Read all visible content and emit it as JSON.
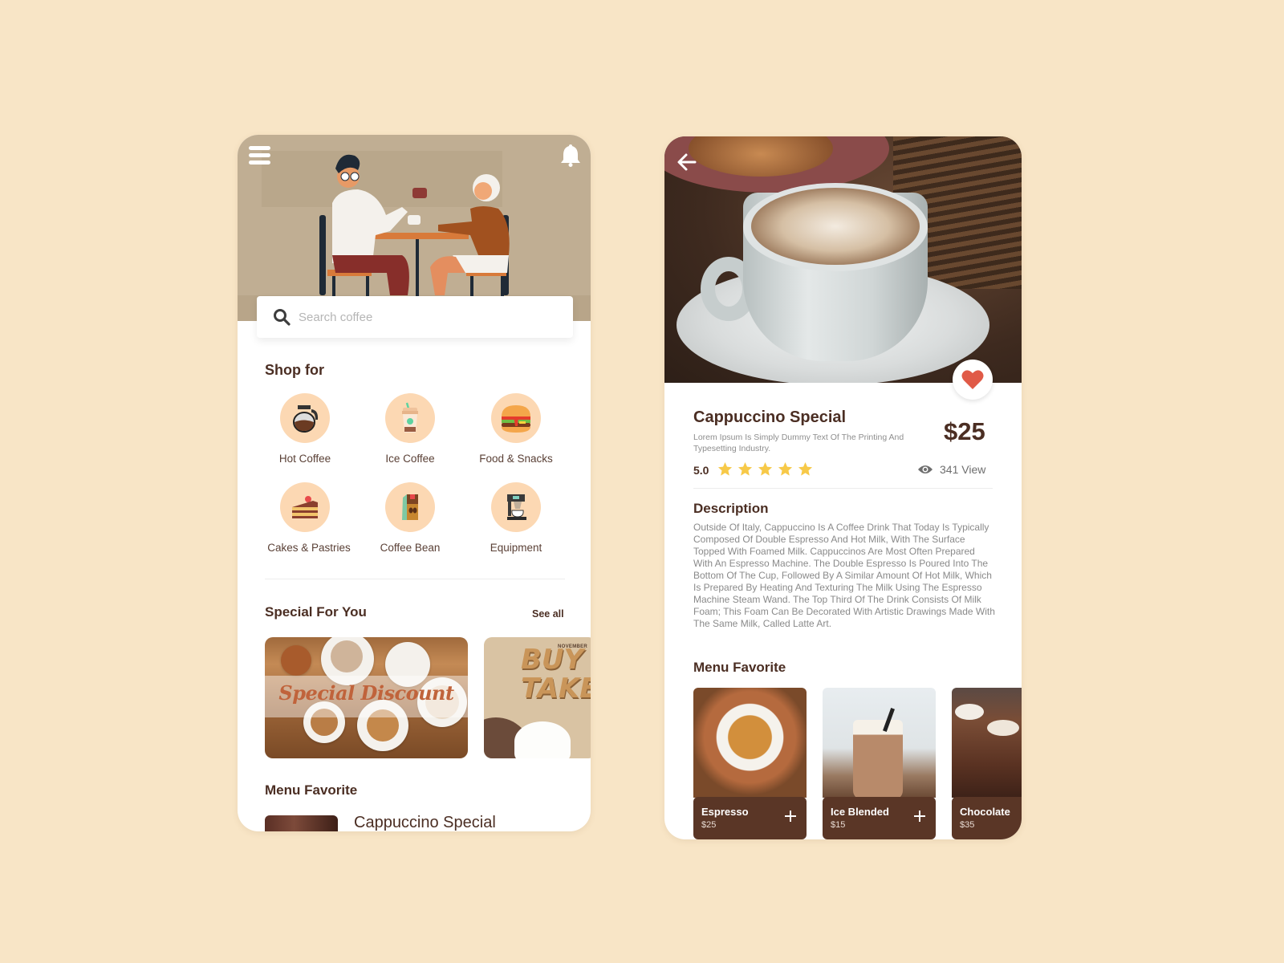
{
  "colors": {
    "background": "#f8e5c6",
    "brand_brown": "#4b2e23",
    "card_bar": "#5a3626",
    "category_circle": "#fcd8b3",
    "star": "#f7c948",
    "heart": "#e05a47",
    "hero_bg": "#c0ae93"
  },
  "home": {
    "icons": {
      "menu": "hamburger-menu-icon",
      "notifications": "bell-icon",
      "search": "search-icon"
    },
    "search": {
      "placeholder": "Search coffee",
      "value": ""
    },
    "shop_for": {
      "title": "Shop for",
      "categories": [
        {
          "label": "Hot Coffee",
          "icon": "coffee-pot-icon"
        },
        {
          "label": "Ice Coffee",
          "icon": "iced-coffee-cup-icon"
        },
        {
          "label": "Food & Snacks",
          "icon": "burger-icon"
        },
        {
          "label": "Cakes & Pastries",
          "icon": "cake-slice-icon"
        },
        {
          "label": "Coffee Bean",
          "icon": "coffee-bag-icon"
        },
        {
          "label": "Equipment",
          "icon": "espresso-machine-icon"
        }
      ]
    },
    "special": {
      "title": "Special For You",
      "see_all": "See all",
      "promos": [
        {
          "text": "Special Discount"
        },
        {
          "text": "BUY TAKE",
          "line1": "BUY",
          "line2": "TAKE",
          "tag": "NOVEMBER"
        }
      ]
    },
    "menu_favorite": {
      "title": "Menu Favorite",
      "items": [
        {
          "name": "Cappuccino Special"
        }
      ]
    }
  },
  "detail": {
    "icons": {
      "back": "arrow-left-icon",
      "favorite": "heart-icon",
      "views": "eye-icon",
      "rating": "star-icon"
    },
    "title": "Cappuccino Special",
    "subtitle": "Lorem Ipsum Is Simply Dummy Text Of The Printing And Typesetting Industry.",
    "price": "$25",
    "rating": "5.0",
    "stars": 5,
    "views": "341 View",
    "description_title": "Description",
    "description": "Outside Of Italy, Cappuccino Is A Coffee Drink That Today Is Typically Composed Of Double Espresso And Hot Milk, With The Surface Topped With Foamed Milk. Cappuccinos Are Most Often Prepared With An Espresso Machine. The Double Espresso Is Poured Into The Bottom Of The Cup, Followed By A Similar Amount Of Hot Milk, Which Is Prepared By Heating And Texturing The Milk Using The Espresso Machine Steam Wand. The Top Third Of The Drink Consists Of Milk Foam; This Foam Can Be Decorated With Artistic Drawings Made With The Same Milk, Called Latte Art.",
    "menu_favorite": {
      "title": "Menu Favorite",
      "items": [
        {
          "name": "Espresso",
          "price": "$25"
        },
        {
          "name": "Ice Blended",
          "price": "$15"
        },
        {
          "name": "Chocolate",
          "price": "$35"
        }
      ]
    }
  }
}
